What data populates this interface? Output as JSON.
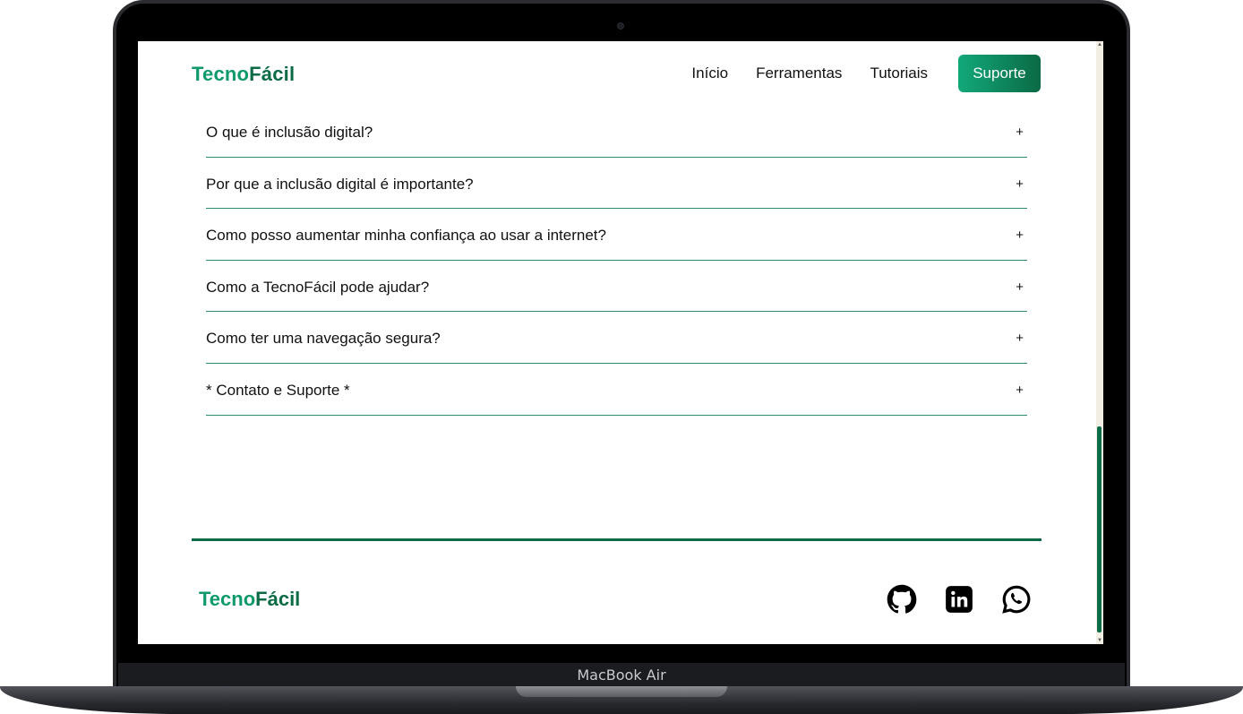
{
  "device": {
    "label": "MacBook Air"
  },
  "header": {
    "logo_part1": "Tecno",
    "logo_part2": "Fácil",
    "nav": [
      "Início",
      "Ferramentas",
      "Tutoriais"
    ],
    "cta": "Suporte"
  },
  "faq": [
    {
      "question": "O que é inclusão digital?",
      "toggle": "+"
    },
    {
      "question": "Por que a inclusão digital é importante?",
      "toggle": "+"
    },
    {
      "question": "Como posso aumentar minha confiança ao usar a internet?",
      "toggle": "+"
    },
    {
      "question": "Como a TecnoFácil pode ajudar?",
      "toggle": "+"
    },
    {
      "question": "Como ter uma navegação segura?",
      "toggle": "+"
    },
    {
      "question": "* Contato e Suporte *",
      "toggle": "+"
    }
  ],
  "footer": {
    "logo_part1": "Tecno",
    "logo_part2": "Fácil",
    "socials": [
      "github-icon",
      "linkedin-icon",
      "whatsapp-icon"
    ]
  },
  "colors": {
    "brand_light": "#0f9a6a",
    "brand_dark": "#0b6b45",
    "scrollbar_track": "#f3eee4"
  }
}
